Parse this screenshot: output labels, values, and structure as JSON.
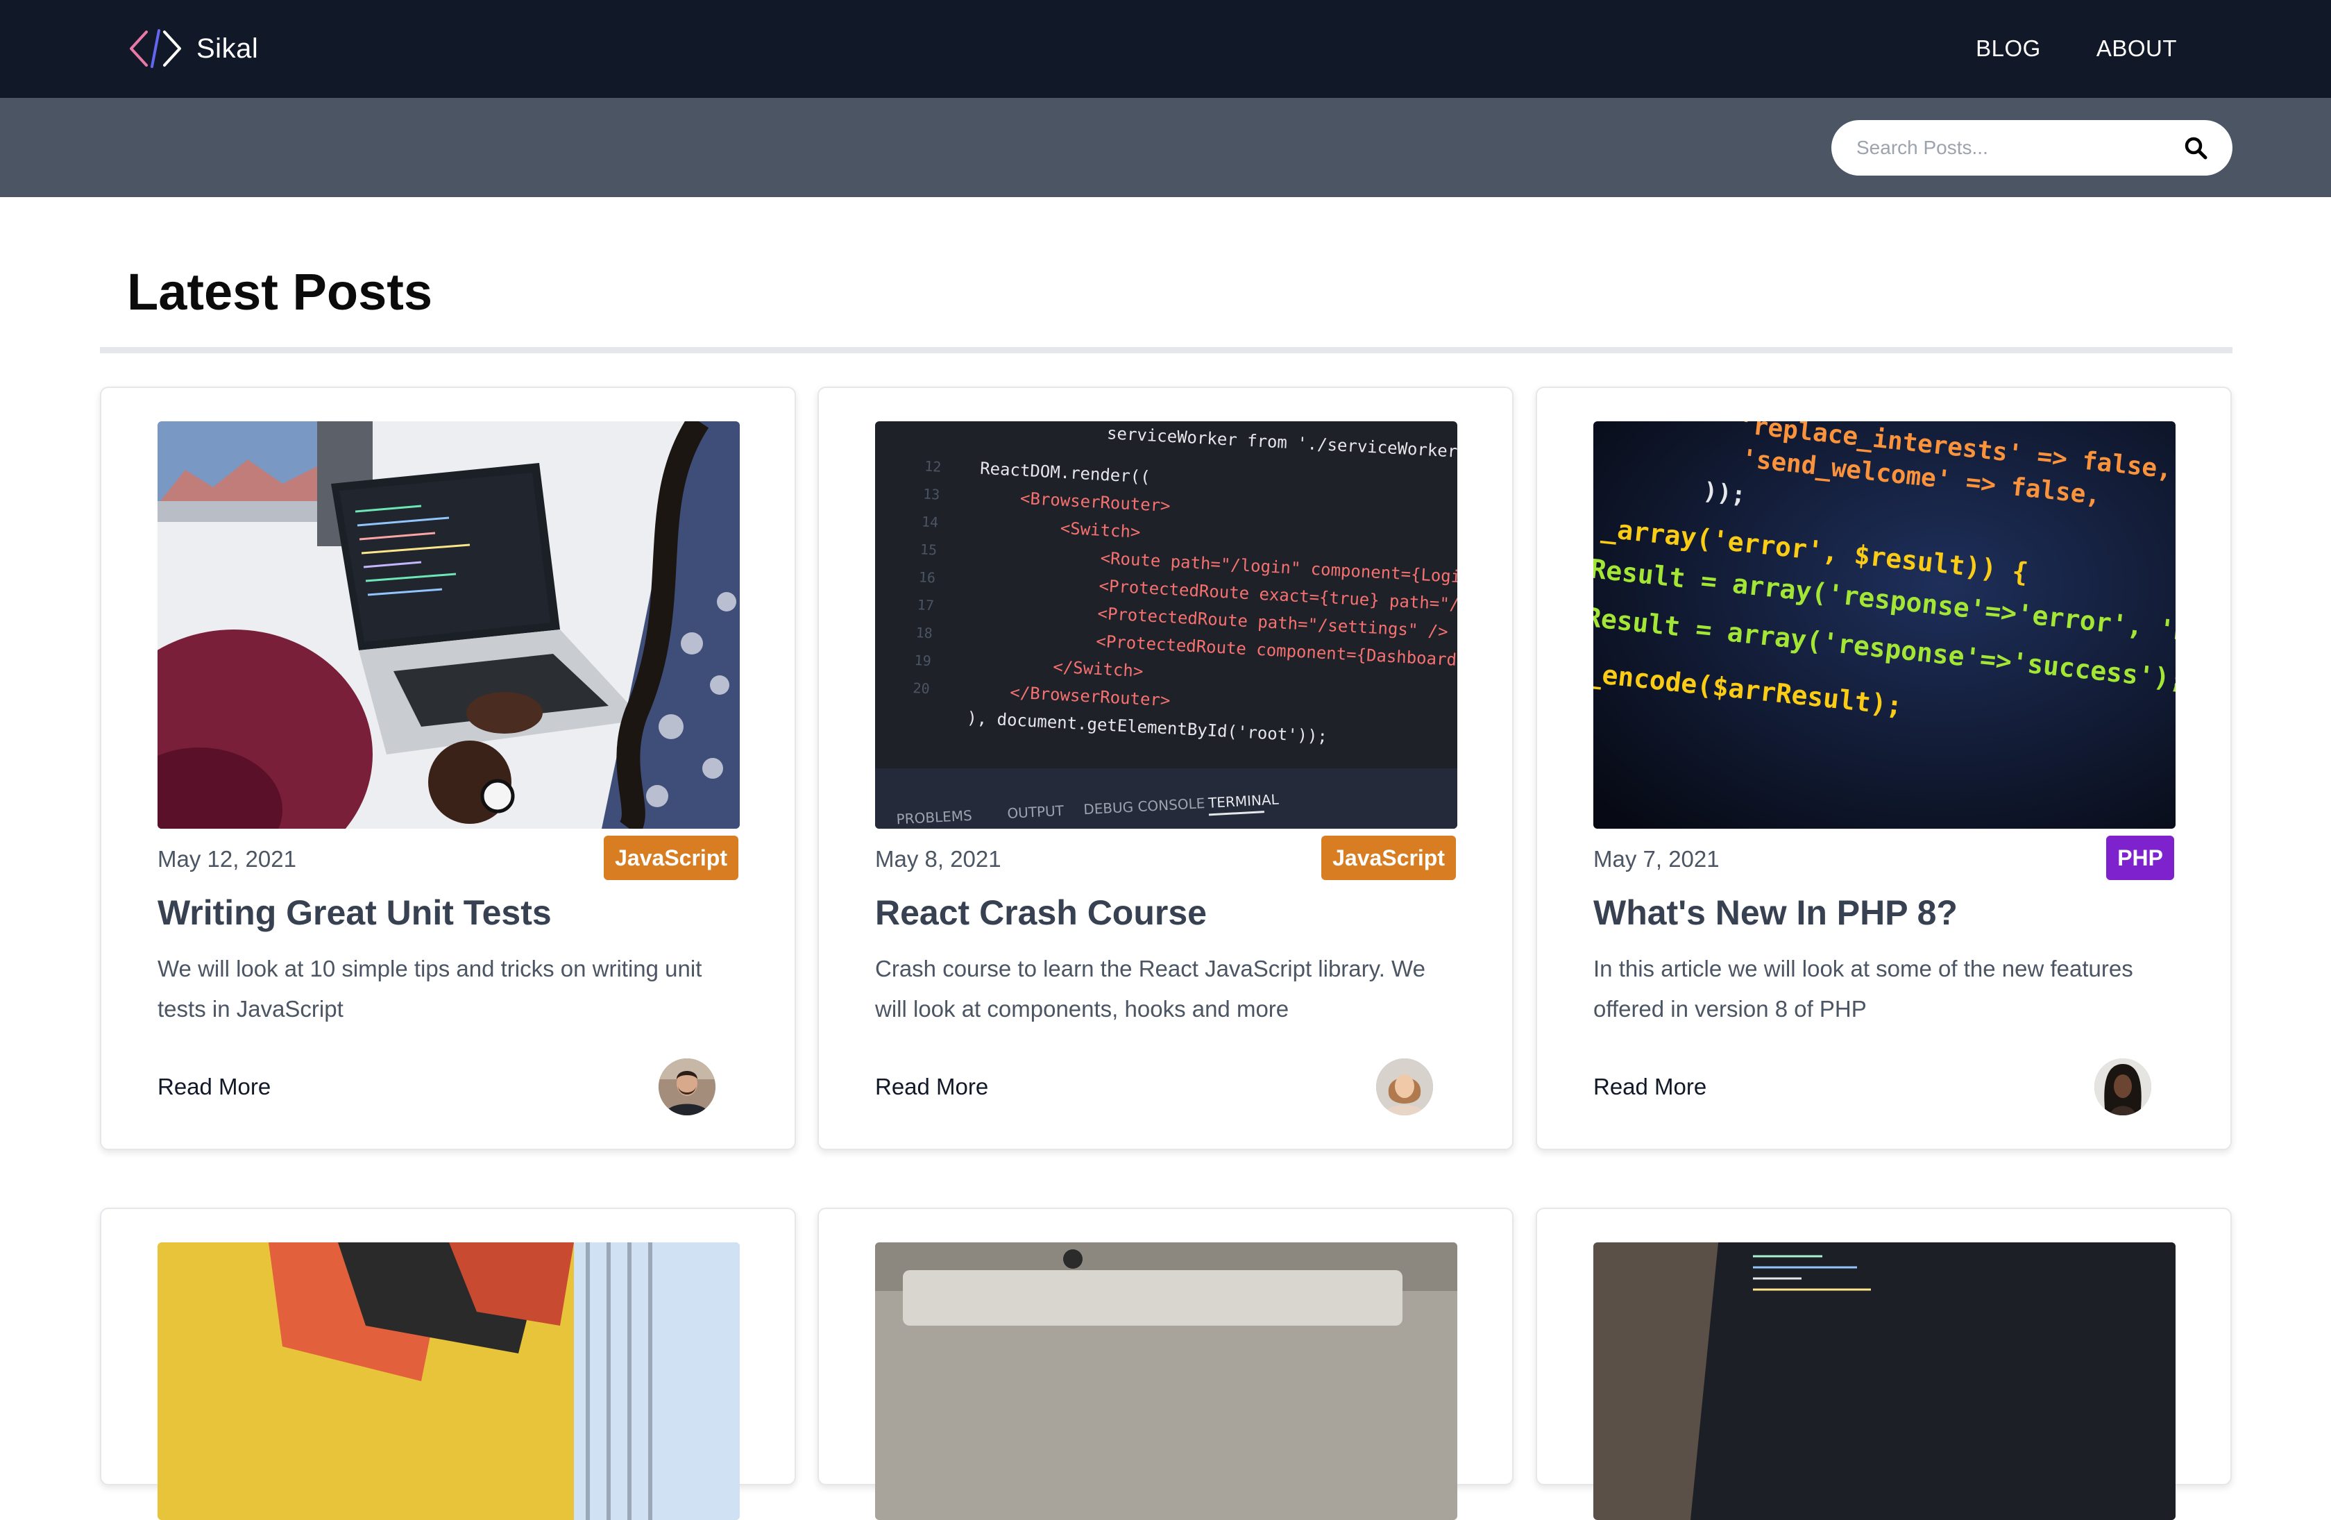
{
  "navbar": {
    "brand_name": "Sikal",
    "links": [
      {
        "label": "BLOG"
      },
      {
        "label": "ABOUT"
      }
    ]
  },
  "search": {
    "placeholder": "Search Posts..."
  },
  "page_title": "Latest Posts",
  "colors": {
    "navbar_bg": "#111827",
    "search_strip_bg": "#4b5563",
    "tag_javascript": "#d97d22",
    "tag_php": "#7e22ce"
  },
  "posts": [
    {
      "date": "May 12, 2021",
      "tag": "JavaScript",
      "title": "Writing Great Unit Tests",
      "excerpt": "We will look at 10 simple tips and tricks on writing unit tests in JavaScript",
      "read_more": "Read More"
    },
    {
      "date": "May 8, 2021",
      "tag": "JavaScript",
      "title": "React Crash Course",
      "excerpt": "Crash course to learn the React JavaScript library. We will look at components, hooks and more",
      "read_more": "Read More"
    },
    {
      "date": "May 7, 2021",
      "tag": "PHP",
      "title": "What's New In PHP 8?",
      "excerpt": "In this article we will look at some of the new features offered in version 8 of PHP",
      "read_more": "Read More"
    }
  ],
  "code_snippets": {
    "react": [
      "serviceWorker from './serviceWorker'",
      "ReactDOM.render((",
      "<BrowserRouter>",
      "<Switch>",
      "<Route path=\"/login\" component={Login} />",
      "<ProtectedRoute exact={true} path=\"/\" />",
      "<ProtectedRoute path=\"/settings\" />",
      "<ProtectedRoute component={Dashboard} />",
      "</Switch>",
      "</BrowserRouter>",
      "), document.getElementById('root'));",
      "PROBLEMS",
      "OUTPUT",
      "DEBUG CONSOLE",
      "TERMINAL"
    ],
    "php": [
      "'replace_interests' => false,",
      "'send_welcome' => false,",
      "));",
      "_array('error', $result)) {",
      "Result = array('response'=>'error', 'message'",
      "Result = array('response'=>'success');",
      "_encode($arrResult);"
    ]
  }
}
